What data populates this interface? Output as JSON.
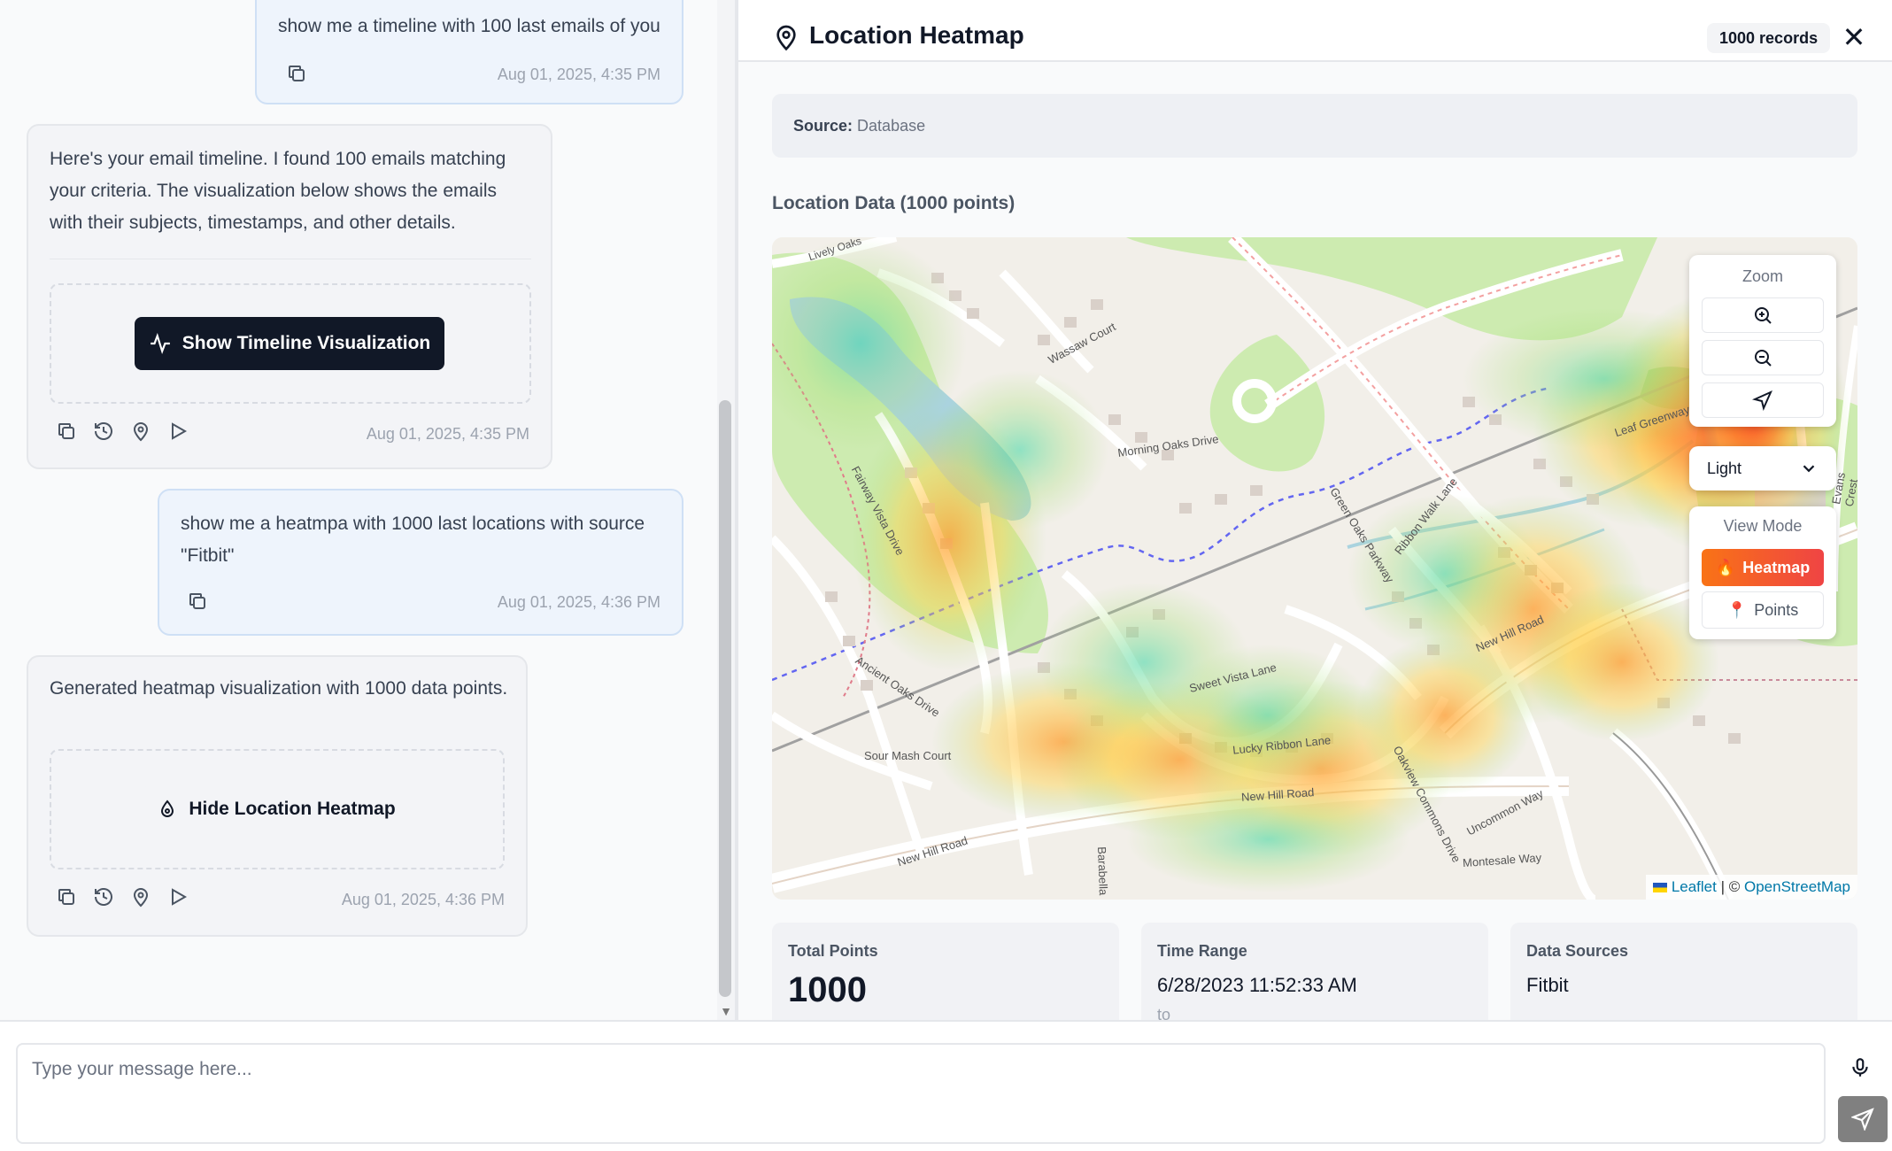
{
  "chat": {
    "messages": [
      {
        "role": "user",
        "text": "show me a timeline with 100 last emails of you",
        "timestamp": "Aug 01, 2025, 4:35 PM"
      },
      {
        "role": "assistant",
        "lines": [
          "Here's your email timeline. I found 100 emails matching",
          "your criteria. The visualization below shows the emails",
          "with their subjects, timestamps, and other details."
        ],
        "button_label": "Show Timeline Visualization",
        "timestamp": "Aug 01, 2025, 4:35 PM"
      },
      {
        "role": "user",
        "lines": [
          "show me a heatmpa with 1000 last locations with source",
          "\"Fitbit\""
        ],
        "timestamp": "Aug 01, 2025, 4:36 PM"
      },
      {
        "role": "assistant",
        "text": "Generated heatmap visualization with 1000 data points.",
        "button_label": "Hide Location Heatmap",
        "timestamp": "Aug 01, 2025, 4:36 PM"
      }
    ]
  },
  "heatmap_panel": {
    "title": "Location Heatmap",
    "records_badge": "1000 records",
    "close_icon": "close-icon",
    "source_label": "Source:",
    "source_value": "Database",
    "section_title": "Location Data (1000 points)",
    "controls": {
      "zoom_label": "Zoom",
      "theme_value": "Light",
      "view_mode_label": "View Mode",
      "heatmap_label": "Heatmap",
      "points_label": "Points"
    },
    "attribution": {
      "leaflet": "Leaflet",
      "separator": " | © ",
      "osm": "OpenStreetMap"
    },
    "map_labels": {
      "lively_oaks": "Lively Oaks",
      "wassaw_court": "Wassaw Court",
      "morning_oaks": "Morning Oaks Drive",
      "fairway_vista": "Fairway Vista Drive",
      "green_oaks": "Green Oaks Parkway",
      "ribbon_walk": "Ribbon Walk Lane",
      "ancient_oaks": "Ancient Oaks Drive",
      "sweet_vista": "Sweet Vista Lane",
      "sour_mash": "Sour Mash Court",
      "lucky_ribbon": "Lucky Ribbon Lane",
      "new_hill_road": "New Hill Road",
      "oakview_commons": "Oakview Commons Drive",
      "uncommon_way": "Uncommon Way",
      "montesale_way": "Montesale Way",
      "leaf_greenway": "Leaf Greenway",
      "evans_crest": "Evans Crest Lane",
      "barabella": "Barabella"
    },
    "stats": {
      "total_points_label": "Total Points",
      "total_points_value": "1000",
      "time_range_label": "Time Range",
      "time_range_start": "6/28/2023 11:52:33 AM",
      "time_range_to": "to",
      "data_sources_label": "Data Sources",
      "data_sources_value": "Fitbit"
    }
  },
  "composer": {
    "placeholder": "Type your message here..."
  }
}
